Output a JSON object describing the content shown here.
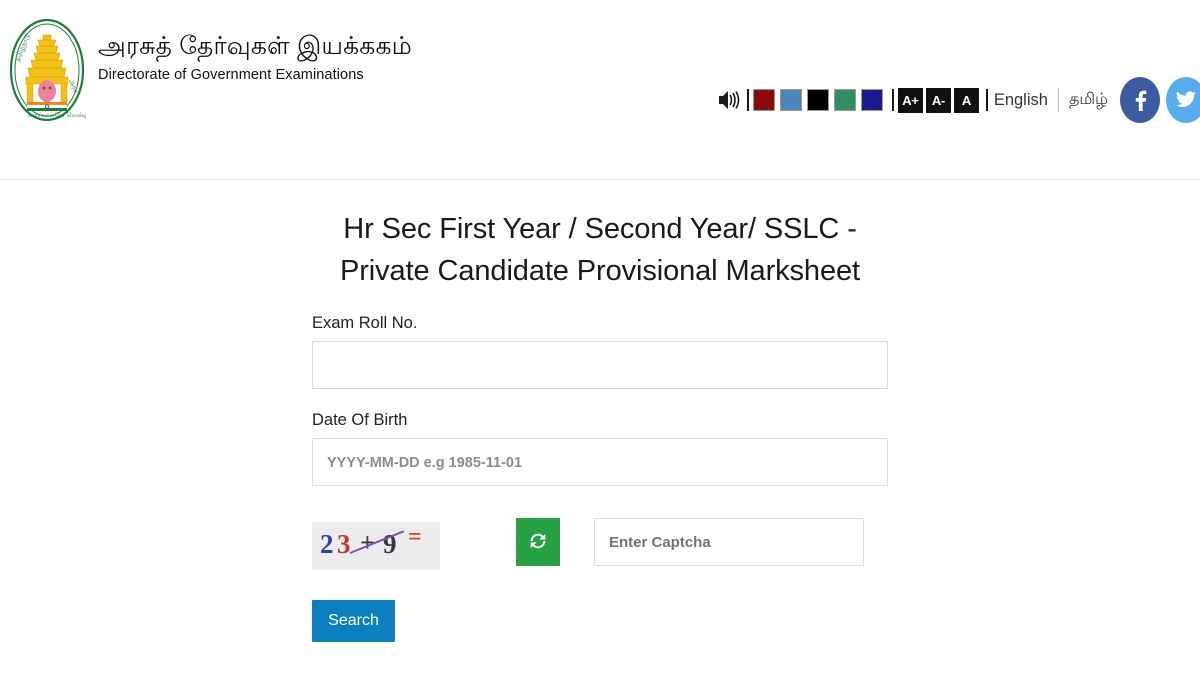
{
  "header": {
    "emblem_icon": "tamil-nadu-government-emblem-icon",
    "brand_tamil": "அரசுத் தேர்வுகள் இயக்ககம்",
    "brand_english": "Directorate of Government Examinations",
    "accessibility": {
      "speaker_icon": "speaker-sound-icon",
      "theme_swatches": [
        {
          "name": "dark-red",
          "color": "#8b0a0a"
        },
        {
          "name": "steel-blue",
          "color": "#4a86b8"
        },
        {
          "name": "black",
          "color": "#000000"
        },
        {
          "name": "sea-green",
          "color": "#2f8e5b"
        },
        {
          "name": "navy-blue",
          "color": "#1b1b8f"
        }
      ],
      "font_size_buttons": [
        {
          "name": "increase",
          "label": "A+"
        },
        {
          "name": "decrease",
          "label": "A-"
        },
        {
          "name": "reset",
          "label": "A"
        }
      ],
      "languages": [
        {
          "name": "english",
          "label": "English"
        },
        {
          "name": "tamil",
          "label": "தமிழ்"
        }
      ],
      "social": [
        {
          "name": "facebook",
          "glyph": "f",
          "color": "#3b5ca0"
        },
        {
          "name": "twitter",
          "glyph": "twitter-bird-icon",
          "color": "#59aceb"
        }
      ]
    }
  },
  "main": {
    "title": "Hr Sec First Year / Second Year/ SSLC - Private Candidate Provisional Marksheet",
    "fields": {
      "roll_no": {
        "label": "Exam Roll No.",
        "value": "",
        "placeholder": ""
      },
      "dob": {
        "label": "Date Of Birth",
        "value": "",
        "placeholder": "YYYY-MM-DD e.g 1985-11-01"
      },
      "captcha": {
        "value": "",
        "placeholder": "Enter Captcha",
        "image_text": "23 + 9 =",
        "chars": {
          "a": "2",
          "b": "3",
          "op": "+",
          "c": "9",
          "eq": "="
        },
        "refresh_icon": "refresh-sync-icon",
        "refresh_color": "#27a143"
      }
    },
    "search_button": {
      "label": "Search",
      "color": "#0c80bf"
    }
  }
}
